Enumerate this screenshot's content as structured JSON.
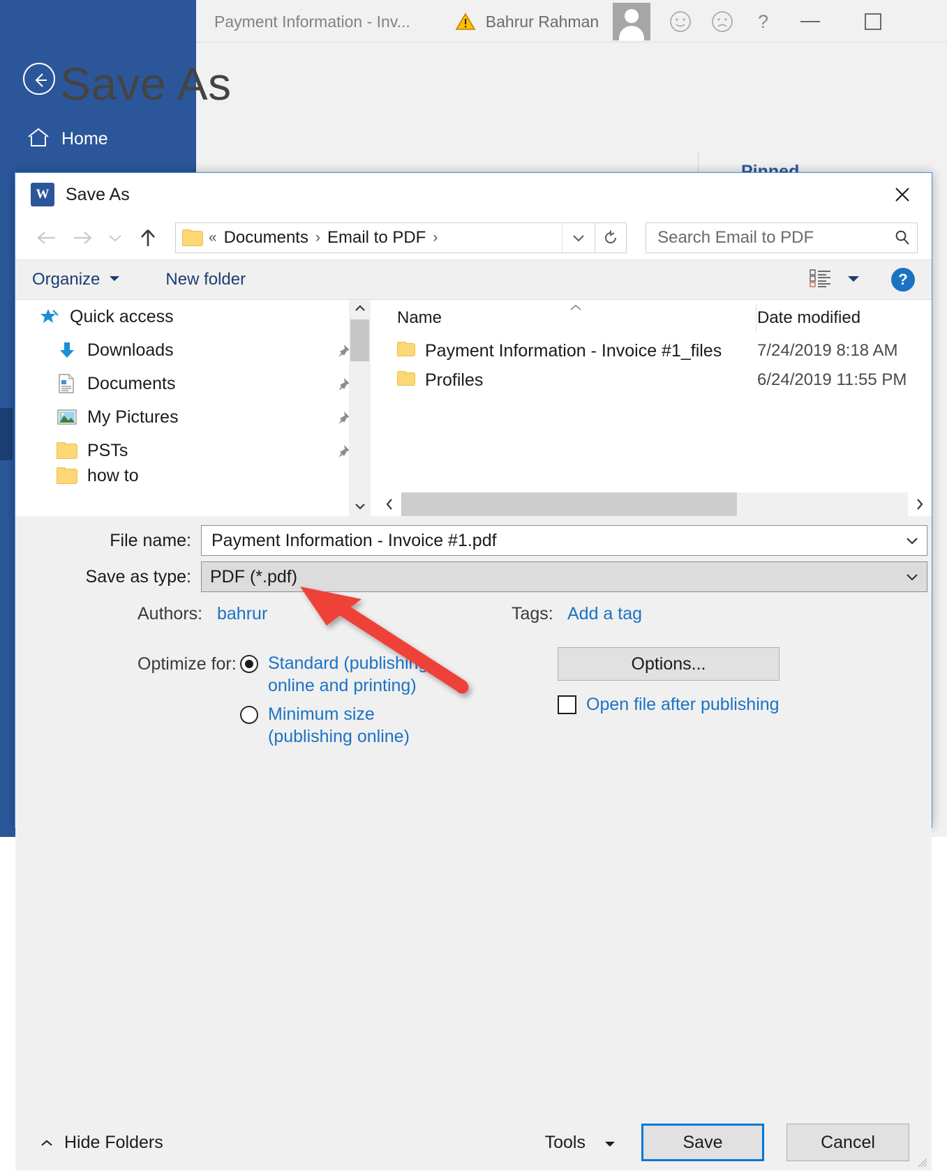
{
  "word_window": {
    "doc_title": "Payment Information - Inv...",
    "user_name": "Bahrur Rahman",
    "warning_icon": "warning-triangle-icon",
    "smile_icon": "smiley-face-icon",
    "frown_icon": "frowny-face-icon",
    "help_label": "?",
    "minimize_label": "",
    "restore_label": "",
    "back_icon": "back-arrow-icon",
    "home_label": "Home",
    "page_title": "Save As",
    "pinned_label": "Pinned"
  },
  "dialog": {
    "title": "Save As",
    "app_icon_letter": "W",
    "close_icon": "close-icon",
    "nav": {
      "back_icon": "back-arrow-icon",
      "forward_icon": "forward-arrow-icon",
      "recent_icon": "chevron-down-icon",
      "up_icon": "up-arrow-icon",
      "breadcrumb_prefix": "«",
      "crumbs": [
        "Documents",
        "Email to PDF"
      ],
      "separator": "›",
      "dropdown_icon": "chevron-down-icon",
      "refresh_icon": "refresh-icon"
    },
    "search": {
      "placeholder": "Search Email to PDF",
      "value": "",
      "icon": "search-icon"
    },
    "toolbar": {
      "organize_label": "Organize",
      "organize_caret": "▼",
      "new_folder_label": "New folder",
      "view_icon": "view-layout-icon",
      "view_caret": "▼",
      "help_label": "?"
    },
    "nav_pane": {
      "items": [
        {
          "label": "Quick access",
          "icon": "star-pin-icon",
          "pinned": false,
          "root": true
        },
        {
          "label": "Downloads",
          "icon": "download-arrow-icon",
          "pinned": true,
          "root": false
        },
        {
          "label": "Documents",
          "icon": "document-icon",
          "pinned": true,
          "root": false
        },
        {
          "label": "My Pictures",
          "icon": "picture-icon",
          "pinned": true,
          "root": false
        },
        {
          "label": "PSTs",
          "icon": "folder-icon",
          "pinned": true,
          "root": false
        },
        {
          "label": "how to",
          "icon": "folder-icon",
          "pinned": false,
          "root": false
        }
      ],
      "pin_icon": "pushpin-icon",
      "scroll_up_icon": "chevron-up-icon",
      "scroll_down_icon": "chevron-down-icon"
    },
    "file_list": {
      "columns": [
        "Name",
        "Date modified"
      ],
      "sort_indicator": "sort-ascending-caret",
      "rows": [
        {
          "name": "Payment Information - Invoice #1_files",
          "date": "7/24/2019 8:18 AM",
          "icon": "folder-icon"
        },
        {
          "name": "Profiles",
          "date": "6/24/2019 11:55 PM",
          "icon": "folder-icon"
        }
      ],
      "hscroll_left_icon": "chevron-left-icon",
      "hscroll_right_icon": "chevron-right-icon"
    },
    "form": {
      "file_name_label": "File name:",
      "file_name_value": "Payment Information - Invoice #1.pdf",
      "file_name_caret": "chevron-down-icon",
      "save_type_label": "Save as type:",
      "save_type_value": "PDF (*.pdf)",
      "save_type_caret": "chevron-down-icon",
      "authors_label": "Authors:",
      "authors_value": "bahrur",
      "tags_label": "Tags:",
      "tags_value": "Add a tag",
      "optimize_label": "Optimize for:",
      "optimize_options": [
        {
          "label": "Standard (publishing online and printing)",
          "selected": true
        },
        {
          "label": "Minimum size (publishing online)",
          "selected": false
        }
      ],
      "options_button": "Options...",
      "open_after_publish_label": "Open file after publishing",
      "open_after_publish_checked": false
    },
    "footer": {
      "hide_folders_label": "Hide Folders",
      "hide_folders_caret": "ⱏ",
      "tools_label": "Tools",
      "tools_caret": "▼",
      "save_label": "Save",
      "cancel_label": "Cancel"
    }
  },
  "annotation": {
    "arrow_color": "#ee4338",
    "points_at": "Save as type field"
  },
  "colors": {
    "word_blue": "#2b579a",
    "accent_blue": "#0078d7",
    "link_blue": "#1b72c4",
    "folder_yellow": "#fbd775",
    "dialog_bg": "#f0f0f0"
  }
}
